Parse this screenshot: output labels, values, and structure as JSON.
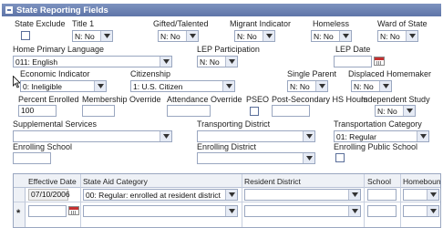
{
  "section": {
    "title": "State Reporting Fields"
  },
  "row1": {
    "state_exclude_label": "State Exclude",
    "title1_label": "Title 1",
    "title1_value": "N: No",
    "gifted_label": "Gifted/Talented",
    "gifted_value": "N: No",
    "migrant_label": "Migrant Indicator",
    "migrant_value": "N: No",
    "homeless_label": "Homeless",
    "homeless_value": "N: No",
    "ward_label": "Ward of State",
    "ward_value": "N: No"
  },
  "row2": {
    "home_lang_label": "Home Primary Language",
    "home_lang_value": "011: English",
    "lep_part_label": "LEP Participation",
    "lep_part_value": "N: No",
    "lep_date_label": "LEP Date",
    "lep_date_value": ""
  },
  "row3": {
    "econ_label": "Economic Indicator",
    "econ_value": "0: Ineligible",
    "citizenship_label": "Citizenship",
    "citizenship_value": "1: U.S. Citizen",
    "single_parent_label": "Single Parent",
    "single_parent_value": "N: No",
    "displaced_label": "Displaced Homemaker",
    "displaced_value": "N: No"
  },
  "row4": {
    "pct_label": "Percent Enrolled",
    "pct_value": "100",
    "membership_label": "Membership Override",
    "attendance_label": "Attendance Override",
    "pseo_label": "PSEO",
    "post_sec_label": "Post-Secondary HS Hours",
    "indep_label": "Independent Study",
    "indep_value": "N: No"
  },
  "row5": {
    "supp_label": "Supplemental Services",
    "transp_district_label": "Transporting District",
    "transp_cat_label": "Transportation Category",
    "transp_cat_value": "01: Regular"
  },
  "row6": {
    "enroll_school_label": "Enrolling School",
    "enroll_district_label": "Enrolling District",
    "enroll_public_label": "Enrolling Public School"
  },
  "grid": {
    "headers": [
      "Effective Date",
      "State Aid Category",
      "Resident District",
      "School",
      "Homebound"
    ],
    "row1": {
      "effective_date": "07/10/2006",
      "state_aid": "00: Regular: enrolled at resident district"
    },
    "new_row_marker": "*"
  },
  "colors": {
    "header_bar": "#6a80b3",
    "border": "#9aa7c0"
  }
}
